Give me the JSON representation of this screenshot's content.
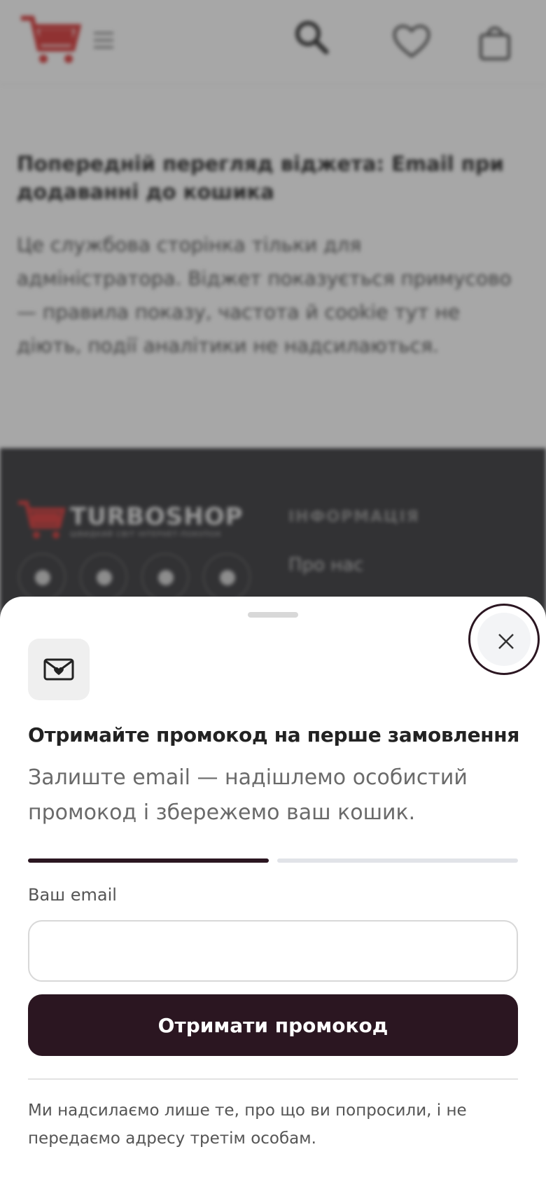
{
  "background_page": {
    "preview_title": "Попередній перегляд віджета: Email при додаванні до кошика",
    "preview_text": "Це службова сторінка тільки для адміністратора. Віджет показується примусово — правила показу, частота й cookie тут не діють, події аналітики не надсилаються.",
    "footer": {
      "brand": "TURBOSHOP",
      "brand_sub": "ШВИДКИЙ СВІТ ІНТЕРНЕТ-ПОКУПОК",
      "info_heading": "ІНФОРМАЦІЯ",
      "link_about": "Про нас",
      "social": [
        "facebook-icon",
        "telegram-icon",
        "instagram-icon",
        "linkedin-icon"
      ]
    }
  },
  "widget": {
    "title": "Отримайте промокод на перше замовлення",
    "subtitle": "Залиште email — надішлемо особистий промокод і збережемо ваш кошик.",
    "progress": {
      "current_step": 1,
      "total_steps": 2
    },
    "email_label": "Ваш email",
    "email_value": "",
    "email_placeholder": "",
    "submit_label": "Отримати промокод",
    "disclaimer": "Ми надсилаємо лише те, про що ви попросили, і не передаємо адресу третім особам."
  },
  "colors": {
    "accent": "#2b1621",
    "brand_red": "#d62b2b",
    "progress_inactive": "#e1e3e8",
    "footer_bg": "#2a2a2e"
  }
}
